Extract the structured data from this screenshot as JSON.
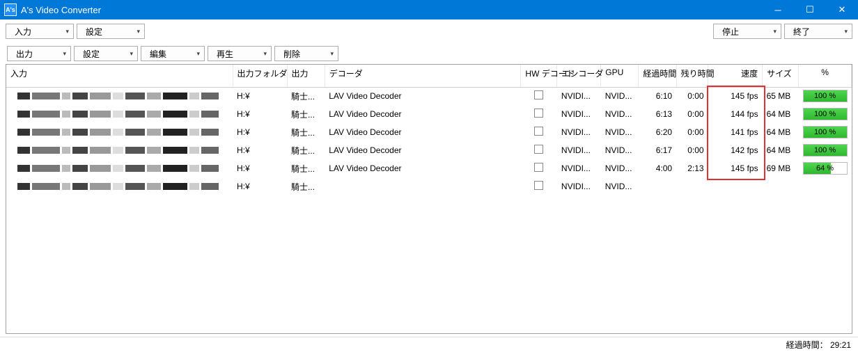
{
  "window": {
    "app_icon_text": "A's",
    "title": "A's Video Converter"
  },
  "top_toolbar": {
    "input": "入力",
    "settings": "設定",
    "stop": "停止",
    "exit": "終了"
  },
  "second_toolbar": {
    "output": "出力",
    "settings": "設定",
    "edit": "編集",
    "play": "再生",
    "delete": "削除"
  },
  "columns": {
    "input": "入力",
    "out_folder": "出力フォルダ",
    "output": "出力",
    "decoder": "デコーダ",
    "hw_decode": "HW デコード",
    "encoder": "エンコーダ",
    "gpu": "GPU",
    "elapsed": "経過時間",
    "remaining": "残り時間",
    "speed": "速度",
    "size": "サイズ",
    "percent": "%"
  },
  "rows": [
    {
      "out_folder": "H:¥",
      "output": "騎士...",
      "decoder": "LAV Video Decoder",
      "hw": false,
      "encoder": "NVIDI...",
      "gpu": "NVID...",
      "elapsed": "6:10",
      "remaining": "0:00",
      "speed": "145 fps",
      "size": "65 MB",
      "percent": 100,
      "percent_label": "100 %"
    },
    {
      "out_folder": "H:¥",
      "output": "騎士...",
      "decoder": "LAV Video Decoder",
      "hw": false,
      "encoder": "NVIDI...",
      "gpu": "NVID...",
      "elapsed": "6:13",
      "remaining": "0:00",
      "speed": "144 fps",
      "size": "64 MB",
      "percent": 100,
      "percent_label": "100 %"
    },
    {
      "out_folder": "H:¥",
      "output": "騎士...",
      "decoder": "LAV Video Decoder",
      "hw": false,
      "encoder": "NVIDI...",
      "gpu": "NVID...",
      "elapsed": "6:20",
      "remaining": "0:00",
      "speed": "141 fps",
      "size": "64 MB",
      "percent": 100,
      "percent_label": "100 %"
    },
    {
      "out_folder": "H:¥",
      "output": "騎士...",
      "decoder": "LAV Video Decoder",
      "hw": false,
      "encoder": "NVIDI...",
      "gpu": "NVID...",
      "elapsed": "6:17",
      "remaining": "0:00",
      "speed": "142 fps",
      "size": "64 MB",
      "percent": 100,
      "percent_label": "100 %"
    },
    {
      "out_folder": "H:¥",
      "output": "騎士...",
      "decoder": "LAV Video Decoder",
      "hw": false,
      "encoder": "NVIDI...",
      "gpu": "NVID...",
      "elapsed": "4:00",
      "remaining": "2:13",
      "speed": "145 fps",
      "size": "69 MB",
      "percent": 64,
      "percent_label": "64 %"
    },
    {
      "out_folder": "H:¥",
      "output": "騎士...",
      "decoder": "",
      "hw": false,
      "encoder": "NVIDI...",
      "gpu": "NVID...",
      "elapsed": "",
      "remaining": "",
      "speed": "",
      "size": "",
      "percent": null,
      "percent_label": ""
    }
  ],
  "status": {
    "elapsed_label": "経過時間：",
    "elapsed_value": "29:21"
  }
}
